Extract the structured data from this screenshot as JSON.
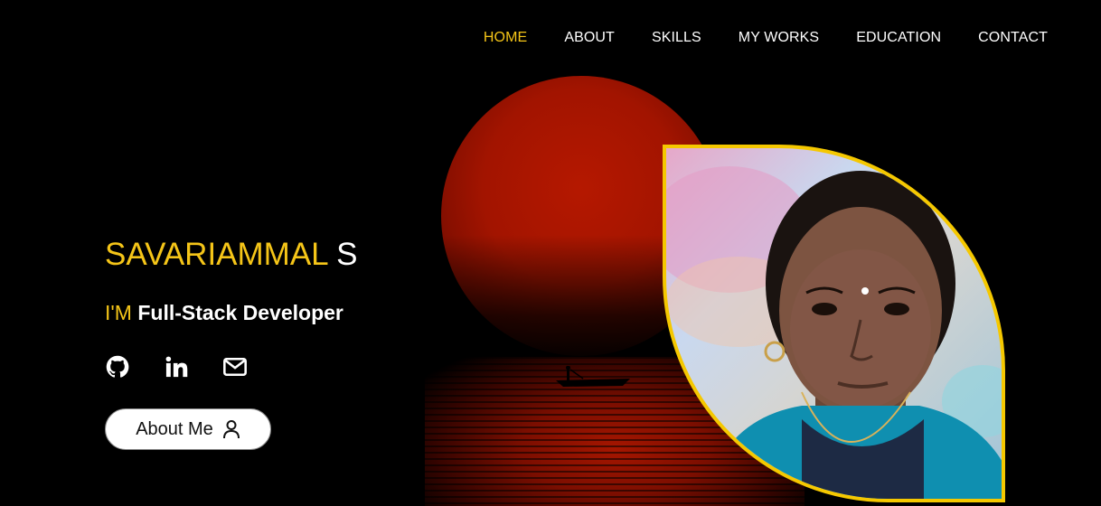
{
  "nav": {
    "items": [
      {
        "label": "HOME",
        "active": true
      },
      {
        "label": "ABOUT",
        "active": false
      },
      {
        "label": "SKILLS",
        "active": false
      },
      {
        "label": "MY WORKS",
        "active": false
      },
      {
        "label": "EDUCATION",
        "active": false
      },
      {
        "label": "CONTACT",
        "active": false
      }
    ]
  },
  "hero": {
    "first_name": "SAVARIAMMAL",
    "last_initial": "S",
    "role_prefix": "I'M",
    "role": "Full-Stack Developer",
    "about_button": "About Me"
  },
  "socials": [
    {
      "icon": "github-icon"
    },
    {
      "icon": "linkedin-icon"
    },
    {
      "icon": "mail-icon"
    }
  ],
  "colors": {
    "accent": "#f5c518",
    "background": "#000000",
    "sun": "#a21400",
    "frame": "#f5c800"
  }
}
